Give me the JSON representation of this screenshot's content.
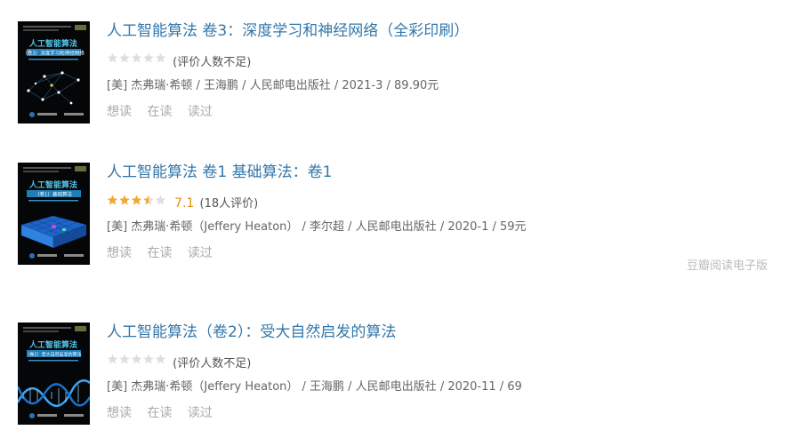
{
  "books": [
    {
      "title": "人工智能算法 卷3：深度学习和神经网络（全彩印刷）",
      "rating_score": "",
      "rating_count": "(评价人数不足)",
      "stars": 0,
      "pub": "[美] 杰弗瑞·希顿 / 王海鹏 / 人民邮电出版社 / 2021-3 / 89.90元",
      "actions": [
        "想读",
        "在读",
        "读过"
      ],
      "cover": {
        "title": "人工智能算法",
        "subtitle": "（卷3）深度学习和神经网络",
        "english": "Artificial Intelligence for Humans",
        "colors": {
          "bg": "#050607",
          "text": "#56c8ee",
          "band": "#1f7db8",
          "node": "#ffffff"
        }
      }
    },
    {
      "title": "人工智能算法 卷1 基础算法：卷1",
      "rating_score": "7.1",
      "rating_count": "(18人评价)",
      "stars": 3.5,
      "pub": "[美] 杰弗瑞·希顿（Jeffery Heaton） / 李尔超 / 人民邮电出版社 / 2020-1 / 59元",
      "actions": [
        "想读",
        "在读",
        "读过"
      ],
      "cover": {
        "title": "人工智能算法",
        "subtitle": "（卷1）基础算法",
        "english": "Artificial Intelligence for Humans",
        "colors": {
          "bg": "#050607",
          "text": "#56c8ee",
          "band": "#1f7db8",
          "grid": "#1e64c8"
        }
      }
    },
    {
      "title": "人工智能算法（卷2）：受大自然启发的算法",
      "rating_score": "",
      "rating_count": "(评价人数不足)",
      "stars": 0,
      "pub": "[美] 杰弗瑞·希顿（Jeffery Heaton） / 王海鹏 / 人民邮电出版社 / 2020-11 / 69",
      "actions": [
        "想读",
        "在读",
        "读过"
      ],
      "cover": {
        "title": "人工智能算法",
        "subtitle": "（卷2）受大自然启发的算法",
        "english": "Artificial Intelligence for Humans",
        "colors": {
          "bg": "#050607",
          "text": "#56c8ee",
          "band": "#1f7db8",
          "helix": "#3aa8f0"
        }
      }
    }
  ],
  "ebook_link": "豆瓣阅读电子版",
  "colors": {
    "title_link": "#3377aa",
    "star_on": "#f4a82b",
    "star_off": "#dddddd"
  }
}
